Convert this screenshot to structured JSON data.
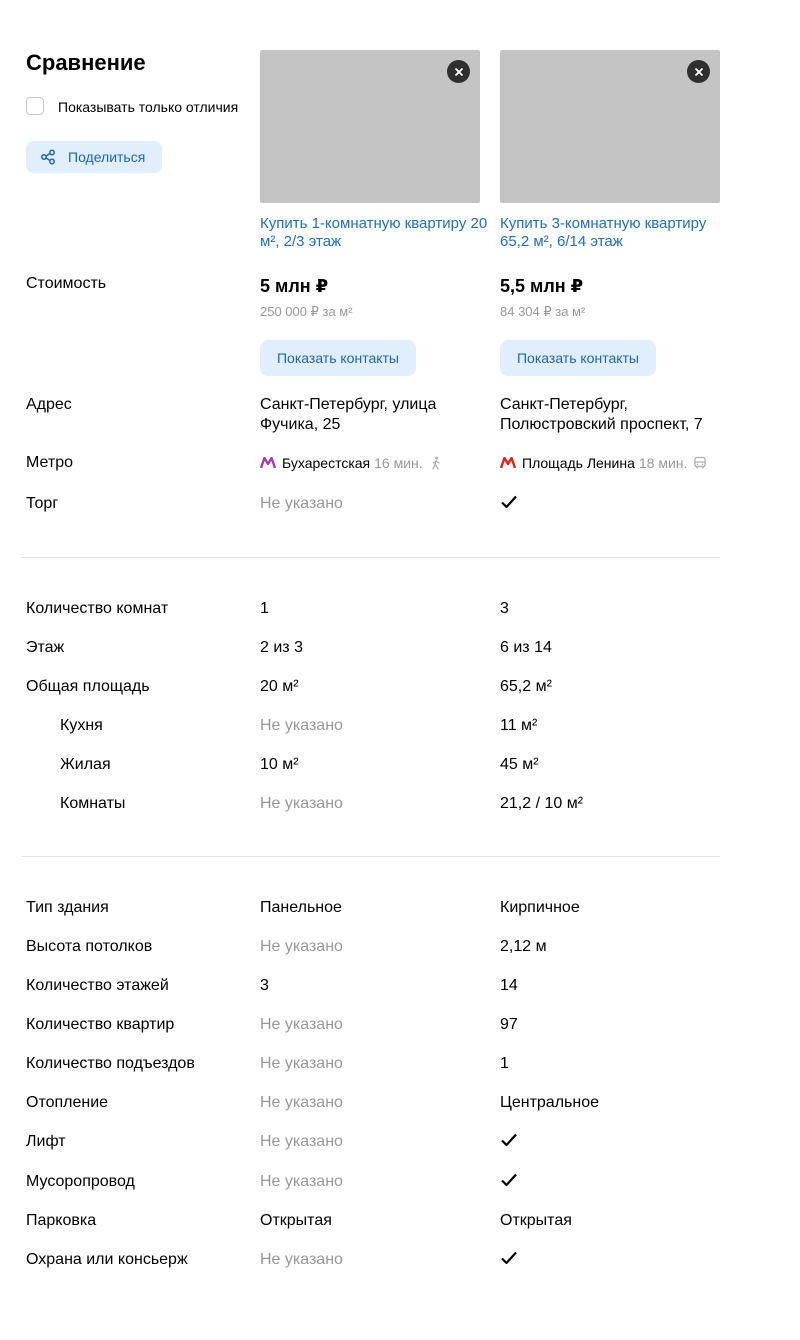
{
  "header": {
    "title": "Сравнение",
    "only_diff_label": "Показывать только отличия",
    "share_label": "Поделиться"
  },
  "offers": [
    {
      "title": "Купить 1-комнатную квартиру 20 м², 2/3 этаж",
      "price": "5 млн ₽",
      "price_per_m2": "250 000 ₽ за м²",
      "contact_label": "Показать контакты",
      "address": "Санкт-Петербург, улица Фучика, 25",
      "metro": {
        "station": "Бухарестская",
        "time": "16 мин.",
        "mode_icon": "walk-icon",
        "line_color": "#a23faf"
      },
      "bargain": "Не указано"
    },
    {
      "title": "Купить 3-комнатную квартиру 65,2 м², 6/14 этаж",
      "price": "5,5 млн ₽",
      "price_per_m2": "84 304 ₽ за м²",
      "contact_label": "Показать контакты",
      "address": "Санкт-Петербург, Полюстровский проспект, 7",
      "metro": {
        "station": "Площадь Ленина",
        "time": "18 мин.",
        "mode_icon": "bus-icon",
        "line_color": "#e42313"
      },
      "bargain": "check"
    }
  ],
  "labels": {
    "price": "Стоимость",
    "address": "Адрес",
    "metro": "Метро",
    "bargain": "Торг"
  },
  "apartment": [
    {
      "label": "Количество комнат",
      "values": [
        "1",
        "3"
      ]
    },
    {
      "label": "Этаж",
      "values": [
        "2 из 3",
        "6 из 14"
      ]
    },
    {
      "label": "Общая площадь",
      "values": [
        "20 м²",
        "65,2 м²"
      ]
    },
    {
      "label": "Кухня",
      "values": [
        "Не указано",
        "11 м²"
      ]
    },
    {
      "label": "Жилая",
      "values": [
        "10 м²",
        "45 м²"
      ]
    },
    {
      "label": "Комнаты",
      "values": [
        "Не указано",
        "21,2 / 10 м²"
      ]
    }
  ],
  "building": [
    {
      "label": "Тип здания",
      "values": [
        "Панельное",
        "Кирпичное"
      ]
    },
    {
      "label": "Высота потолков",
      "values": [
        "Не указано",
        "2,12 м"
      ]
    },
    {
      "label": "Количество этажей",
      "values": [
        "3",
        "14"
      ]
    },
    {
      "label": "Количество квартир",
      "values": [
        "Не указано",
        "97"
      ]
    },
    {
      "label": "Количество подъездов",
      "values": [
        "Не указано",
        "1"
      ]
    },
    {
      "label": "Отопление",
      "values": [
        "Не указано",
        "Центральное"
      ]
    },
    {
      "label": "Лифт",
      "values": [
        "Не указано",
        "check"
      ]
    },
    {
      "label": "Мусоропровод",
      "values": [
        "Не указано",
        "check"
      ]
    },
    {
      "label": "Парковка",
      "values": [
        "Открытая",
        "Открытая"
      ]
    },
    {
      "label": "Охрана или консьерж",
      "values": [
        "Не указано",
        "check"
      ]
    }
  ],
  "colors": {
    "link": "#1b6fc9",
    "button_bg": "#e1effd",
    "muted": "#999999",
    "photo_placeholder": "#c4c4c4"
  }
}
